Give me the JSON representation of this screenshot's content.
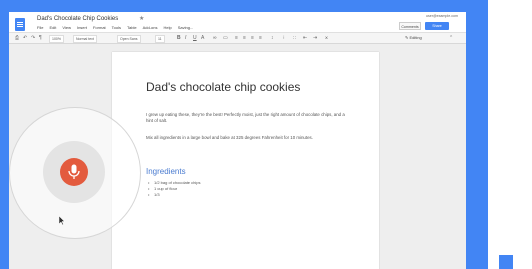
{
  "doc": {
    "title": "Dad's Chocolate Chip Cookies",
    "menu": [
      "File",
      "Edit",
      "View",
      "Insert",
      "Format",
      "Tools",
      "Table",
      "Add-ons",
      "Help",
      "Saving..."
    ],
    "account": "user@example.com",
    "comments_label": "Comments",
    "share_label": "Share"
  },
  "toolbar": {
    "zoom": "100%",
    "style": "Normal text",
    "font": "Open Sans",
    "size": "11",
    "editing_label": "Editing"
  },
  "content": {
    "heading": "Dad's chocolate chip cookies",
    "para1": "I grew up eating these, they're the best! Perfectly moist, just the right amount of chocolate chips, and a hint of salt.",
    "para2": "Mix all ingredients in a large bowl and bake at 325 degrees Fahrenheit for 10 minutes.",
    "ingredients_heading": "Ingredients",
    "ingredients": [
      "1/2 bag of chocolate chips",
      "1 cup of flour",
      "1/3"
    ]
  },
  "colors": {
    "brand": "#4285f4",
    "mic": "#e35b3e"
  },
  "icons": {
    "mic": "microphone-icon",
    "star": "star-icon",
    "cursor": "mouse-cursor-icon"
  }
}
